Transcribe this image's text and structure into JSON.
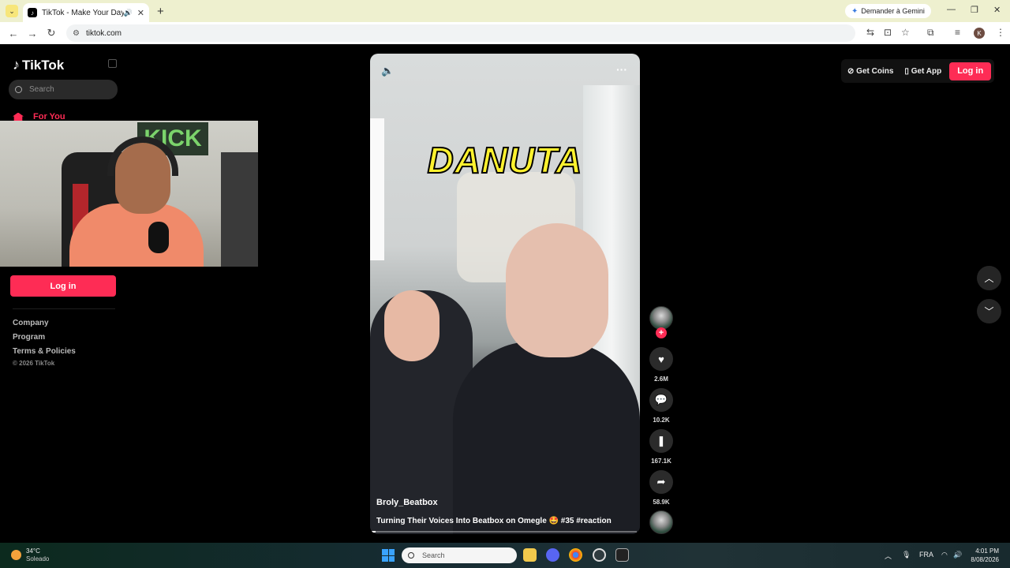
{
  "browser": {
    "tab_title": "TikTok - Make Your Day",
    "gemini_label": "Demander à Gemini",
    "url": "tiktok.com",
    "profile_initial": "K"
  },
  "sidebar": {
    "logo_text": "TikTok",
    "search_placeholder": "Search",
    "nav_for_you": "For You",
    "login_label": "Log in",
    "footer_links": [
      "Company",
      "Program",
      "Terms & Policies"
    ],
    "copyright": "© 2026 TikTok"
  },
  "webcam": {
    "sign_text": "KICK"
  },
  "video": {
    "overlay_caption": "DANUTA",
    "author": "Broly_Beatbox",
    "description": "Turning Their Voices Into Beatbox on Omegle 🤩 #35 #reaction",
    "progress": 0.02
  },
  "actions": {
    "likes": "2.6M",
    "comments": "10.2K",
    "saves": "167.1K",
    "shares": "58.9K"
  },
  "header_right": {
    "get_coins": "Get Coins",
    "get_app": "Get App",
    "login": "Log in"
  },
  "taskbar": {
    "temperature": "34°C",
    "weather": "Soleado",
    "search_placeholder": "Search",
    "language": "FRA",
    "time": "4:01 PM",
    "date": "8/08/2026"
  },
  "colors": {
    "accent": "#fe2c55",
    "caption_yellow": "#fff22e"
  }
}
